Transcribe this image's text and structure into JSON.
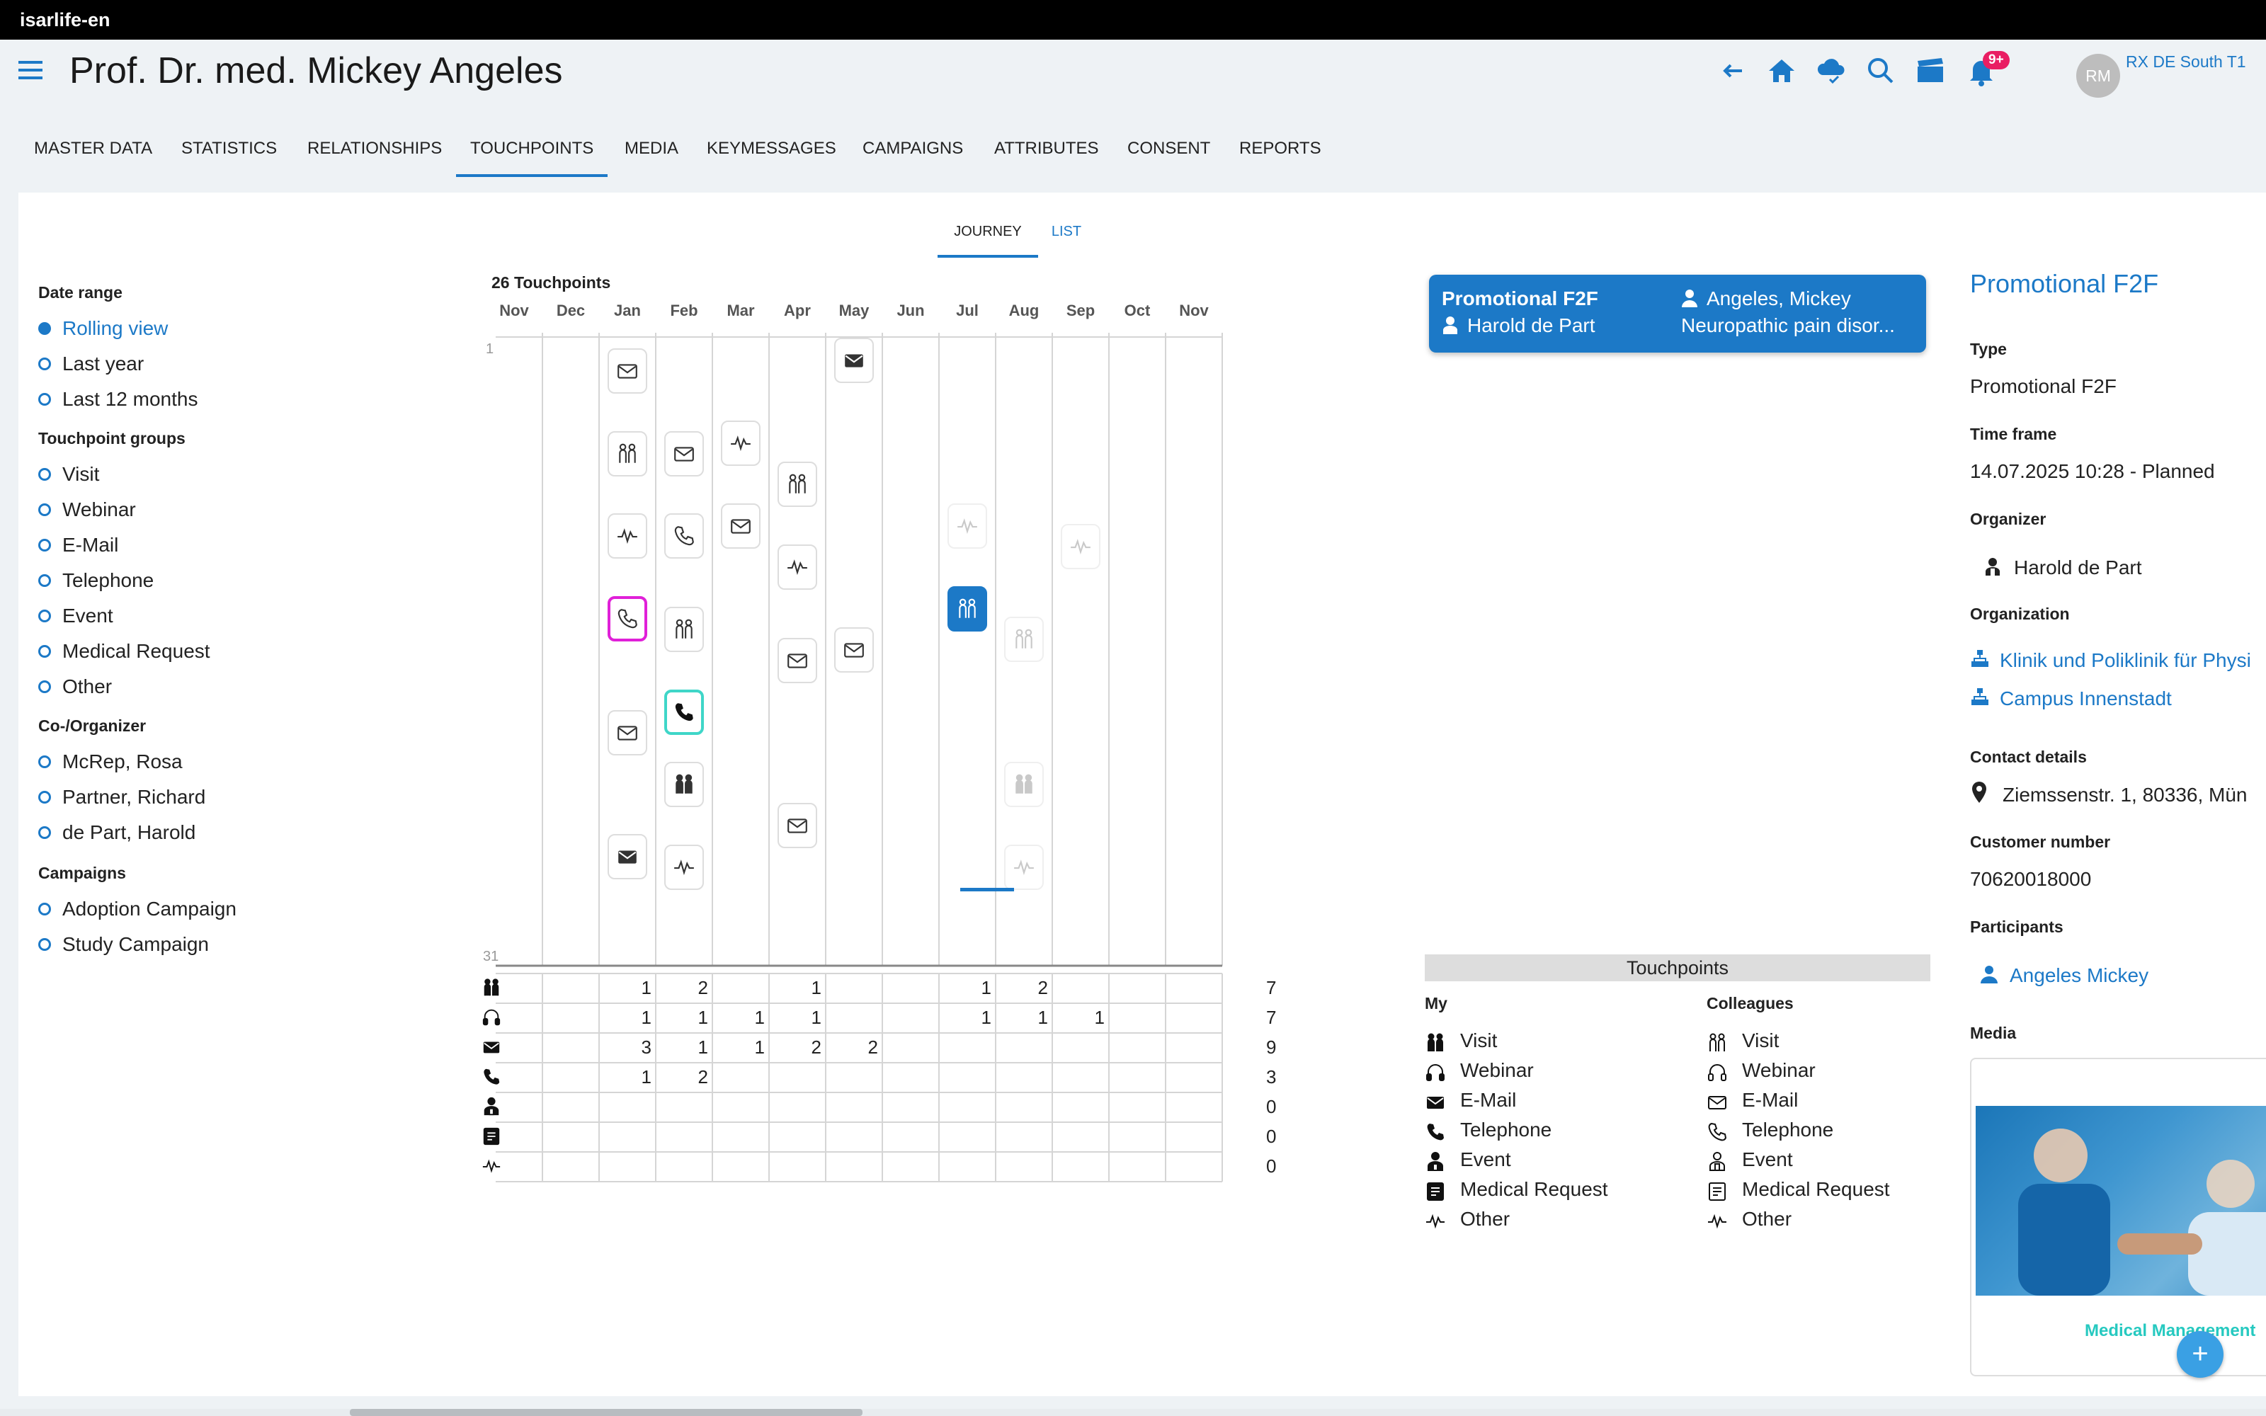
{
  "window": {
    "title": "isarlife-en"
  },
  "header": {
    "title": "Prof. Dr. med. Mickey Angeles",
    "notification_count": "9+",
    "avatar_initials": "RM",
    "territory": "RX DE South T1",
    "icons": [
      "back-arrow-icon",
      "home-icon",
      "cloud-sync-icon",
      "search-icon",
      "clapperboard-icon",
      "bell-icon"
    ]
  },
  "tabs": [
    "MASTER DATA",
    "STATISTICS",
    "RELATIONSHIPS",
    "TOUCHPOINTS",
    "MEDIA",
    "KEYMESSAGES",
    "CAMPAIGNS",
    "ATTRIBUTES",
    "CONSENT",
    "REPORTS"
  ],
  "active_tab": "TOUCHPOINTS",
  "subtabs": {
    "journey": "JOURNEY",
    "list": "LIST"
  },
  "filters": {
    "date_range": {
      "label": "Date range",
      "options": [
        "Rolling view",
        "Last year",
        "Last 12 months"
      ],
      "selected": "Rolling view"
    },
    "touchpoint_groups": {
      "label": "Touchpoint groups",
      "options": [
        "Visit",
        "Webinar",
        "E-Mail",
        "Telephone",
        "Event",
        "Medical Request",
        "Other"
      ]
    },
    "co_organizer": {
      "label": "Co-/Organizer",
      "options": [
        "McRep, Rosa",
        "Partner, Richard",
        "de Part, Harold"
      ]
    },
    "campaigns": {
      "label": "Campaigns",
      "options": [
        "Adoption Campaign",
        "Study Campaign"
      ]
    }
  },
  "journey": {
    "count_label": "26 Touchpoints",
    "months": [
      "Nov",
      "Dec",
      "Jan",
      "Feb",
      "Mar",
      "Apr",
      "May",
      "Jun",
      "Jul",
      "Aug",
      "Sep",
      "Oct",
      "Nov"
    ],
    "day_start": "1",
    "day_end": "31",
    "icons": [
      {
        "month": 2,
        "day": 2.5,
        "type": "email",
        "style": "outline"
      },
      {
        "month": 2,
        "day": 6.5,
        "type": "visit",
        "style": "outline"
      },
      {
        "month": 2,
        "day": 10.5,
        "type": "other",
        "style": "outline"
      },
      {
        "month": 2,
        "day": 14.5,
        "type": "telephone",
        "style": "magenta"
      },
      {
        "month": 2,
        "day": 20,
        "type": "email",
        "style": "outline"
      },
      {
        "month": 2,
        "day": 26,
        "type": "email",
        "style": "solid"
      },
      {
        "month": 3,
        "day": 6.5,
        "type": "email",
        "style": "outline"
      },
      {
        "month": 3,
        "day": 10.5,
        "type": "telephone",
        "style": "outline"
      },
      {
        "month": 3,
        "day": 15,
        "type": "visit",
        "style": "outline"
      },
      {
        "month": 3,
        "day": 19,
        "type": "telephone",
        "style": "teal"
      },
      {
        "month": 3,
        "day": 22.5,
        "type": "visit",
        "style": "solid"
      },
      {
        "month": 3,
        "day": 26.5,
        "type": "other",
        "style": "outline"
      },
      {
        "month": 4,
        "day": 6,
        "type": "other",
        "style": "outline"
      },
      {
        "month": 4,
        "day": 10,
        "type": "email",
        "style": "outline"
      },
      {
        "month": 5,
        "day": 8,
        "type": "visit",
        "style": "outline"
      },
      {
        "month": 5,
        "day": 12,
        "type": "other",
        "style": "outline"
      },
      {
        "month": 5,
        "day": 16.5,
        "type": "email",
        "style": "outline"
      },
      {
        "month": 5,
        "day": 24.5,
        "type": "email",
        "style": "outline"
      },
      {
        "month": 6,
        "day": 2,
        "type": "email",
        "style": "solid"
      },
      {
        "month": 6,
        "day": 16,
        "type": "email",
        "style": "outline"
      },
      {
        "month": 8,
        "day": 10,
        "type": "other",
        "style": "faded"
      },
      {
        "month": 8,
        "day": 14,
        "type": "visit",
        "style": "selected"
      },
      {
        "month": 9,
        "day": 15.5,
        "type": "visit",
        "style": "faded"
      },
      {
        "month": 9,
        "day": 22.5,
        "type": "visit",
        "style": "faded-solid"
      },
      {
        "month": 9,
        "day": 26.5,
        "type": "other",
        "style": "faded"
      },
      {
        "month": 10,
        "day": 11,
        "type": "other",
        "style": "faded"
      }
    ],
    "stats_rows": [
      {
        "icon": "visit-icon",
        "values": [
          "",
          "",
          "1",
          "2",
          "",
          "1",
          "",
          "",
          "1",
          "2",
          "",
          "",
          ""
        ],
        "total": "7"
      },
      {
        "icon": "webinar-icon",
        "values": [
          "",
          "",
          "1",
          "1",
          "1",
          "1",
          "",
          "",
          "1",
          "1",
          "1",
          "",
          ""
        ],
        "total": "7"
      },
      {
        "icon": "email-icon",
        "values": [
          "",
          "",
          "3",
          "1",
          "1",
          "2",
          "2",
          "",
          "",
          "",
          "",
          "",
          ""
        ],
        "total": "9"
      },
      {
        "icon": "telephone-icon",
        "values": [
          "",
          "",
          "1",
          "2",
          "",
          "",
          "",
          "",
          "",
          "",
          "",
          "",
          ""
        ],
        "total": "3"
      },
      {
        "icon": "event-icon",
        "values": [
          "",
          "",
          "",
          "",
          "",
          "",
          "",
          "",
          "",
          "",
          "",
          "",
          ""
        ],
        "total": "0"
      },
      {
        "icon": "medical-request-icon",
        "values": [
          "",
          "",
          "",
          "",
          "",
          "",
          "",
          "",
          "",
          "",
          "",
          "",
          ""
        ],
        "total": "0"
      },
      {
        "icon": "other-icon",
        "values": [
          "",
          "",
          "",
          "",
          "",
          "",
          "",
          "",
          "",
          "",
          "",
          "",
          ""
        ],
        "total": "0"
      }
    ]
  },
  "selected_touchpoint": {
    "type": "Promotional F2F",
    "organizer": "Harold de Part",
    "participant": "Angeles, Mickey",
    "product": "Neuropathic pain disor..."
  },
  "legend": {
    "title": "Touchpoints",
    "my_label": "My",
    "colleagues_label": "Colleagues",
    "items": [
      "Visit",
      "Webinar",
      "E-Mail",
      "Telephone",
      "Event",
      "Medical Request",
      "Other"
    ]
  },
  "detail": {
    "title": "Promotional F2F",
    "type_label": "Type",
    "type_value": "Promotional F2F",
    "timeframe_label": "Time frame",
    "timeframe_value": "14.07.2025 10:28  - Planned",
    "organizer_label": "Organizer",
    "organizer_value": "Harold de Part",
    "organization_label": "Organization",
    "organizations": [
      "Klinik und Poliklinik für Physi",
      "Campus Innenstadt"
    ],
    "contact_label": "Contact details",
    "contact_value": "Ziemssenstr. 1, 80336, Mün",
    "customer_number_label": "Customer number",
    "customer_number_value": "70620018000",
    "participants_label": "Participants",
    "participant_value": "Angeles Mickey",
    "media_label": "Media",
    "media_caption": "Medical Management"
  },
  "colors": {
    "accent": "#1c79c7",
    "magenta": "#e020d8",
    "teal": "#3fd6c8",
    "badge": "#e91e63",
    "media_teal": "#26c9c0"
  }
}
